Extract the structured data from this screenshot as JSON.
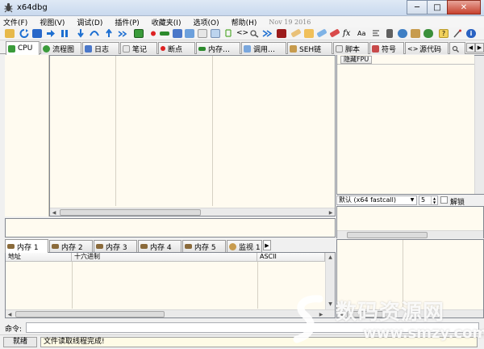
{
  "window": {
    "title": "x64dbg",
    "minimize": "─",
    "maximize": "□",
    "close": "✕"
  },
  "menu": {
    "items": [
      "文件(F)",
      "视图(V)",
      "调试(D)",
      "插件(P)",
      "收藏夹(I)",
      "选项(O)",
      "帮助(H)"
    ],
    "date": "Nov 19 2016"
  },
  "toolbar": {
    "icons": [
      "open-icon",
      "restart-icon",
      "stop-icon",
      "run-icon",
      "pause-icon",
      "step-into-icon",
      "step-over-icon",
      "execute-till-return-icon",
      "run-to-user-code-icon",
      "cpu-icon",
      "breakpoint-icon",
      "memory-map-icon",
      "log-icon",
      "references-icon",
      "threads-icon",
      "source-icon",
      "find-icon",
      "call-stack-icon",
      "patch-icon",
      "trace-icon",
      "comment-icon",
      "label-icon",
      "bookmark-icon",
      "function-icon",
      "font-icon",
      "calculator-icon",
      "settings-icon",
      "plugins-icon",
      "bug-icon",
      "help-icon",
      "about-icon"
    ]
  },
  "tabs": [
    "CPU",
    "流程图",
    "日志",
    "笔记",
    "断点",
    "内存…",
    "调用…",
    "SEH链",
    "脚本",
    "符号",
    "源代码"
  ],
  "registers": {
    "toggle_label": "隐藏FPU"
  },
  "callconv": {
    "selected": "默认 (x64 fastcall)",
    "arg_count": "5",
    "lock_label": "解锁"
  },
  "dump_tabs": [
    "内存 1",
    "内存 2",
    "内存 3",
    "内存 4",
    "内存 5",
    "监视 1"
  ],
  "dump_columns": [
    "地址",
    "十六进制",
    "ASCII"
  ],
  "command": {
    "label": "命令:",
    "value": ""
  },
  "status": {
    "state": "就绪",
    "message": "文件读取线程完成!"
  },
  "watermark": {
    "text": "数码资源网",
    "url": "www.smzy.com"
  },
  "colors": {
    "pane_bg": "#fffbf0",
    "title_bg": "#c9d9ee",
    "status_bg": "#fffbe6"
  }
}
